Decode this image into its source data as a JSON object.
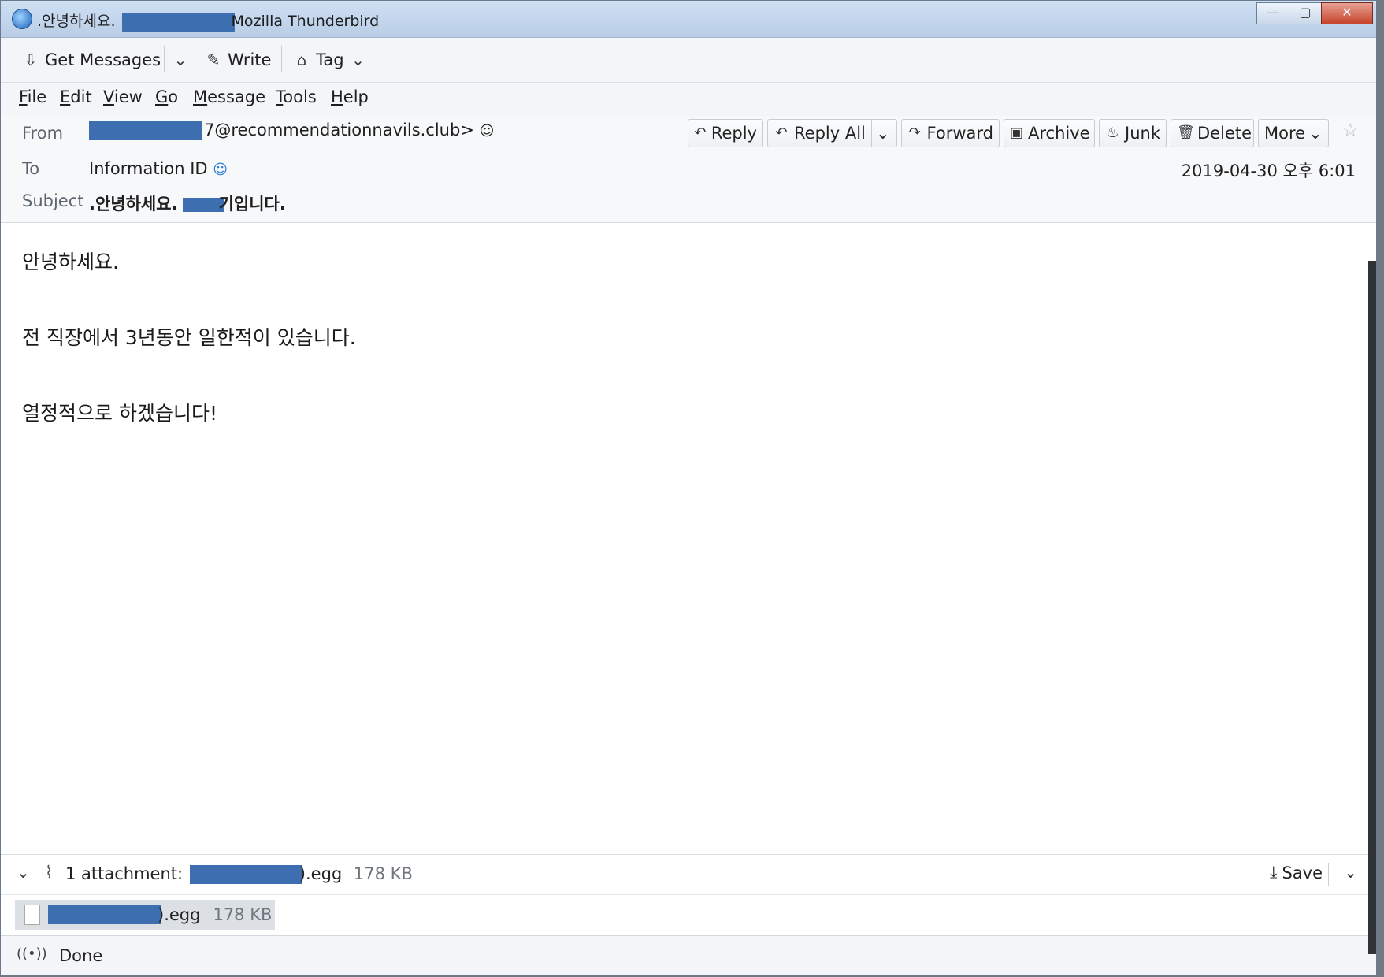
{
  "window": {
    "title_prefix": ".안녕하세요.",
    "title_suffix": "Mozilla Thunderbird",
    "controls": {
      "minimize": "—",
      "maximize": "▢",
      "close": "✕"
    }
  },
  "toolbar": {
    "get_messages": "Get Messages",
    "write": "Write",
    "tag": "Tag"
  },
  "menu": [
    "File",
    "Edit",
    "View",
    "Go",
    "Message",
    "Tools",
    "Help"
  ],
  "header": {
    "from_label": "From",
    "from_value": "7@recommendationnavils.club>",
    "to_label": "To",
    "to_value": "Information ID",
    "subject_label": "Subject",
    "subject_prefix": ".안녕하세요.",
    "subject_suffix": "기입니다.",
    "date": "2019-04-30 오후 6:01",
    "actions": {
      "reply": "Reply",
      "reply_all": "Reply All",
      "forward": "Forward",
      "archive": "Archive",
      "junk": "Junk",
      "delete": "Delete",
      "more": "More"
    }
  },
  "body": {
    "line1": "안녕하세요.",
    "line2": "전 직장에서 3년동안 일한적이 있습니다.",
    "line3": "열정적으로 하겠습니다!"
  },
  "attachment": {
    "summary_label": "1 attachment:",
    "ext": ").egg",
    "size": "178 KB",
    "save": "Save"
  },
  "status": {
    "text": "Done"
  }
}
